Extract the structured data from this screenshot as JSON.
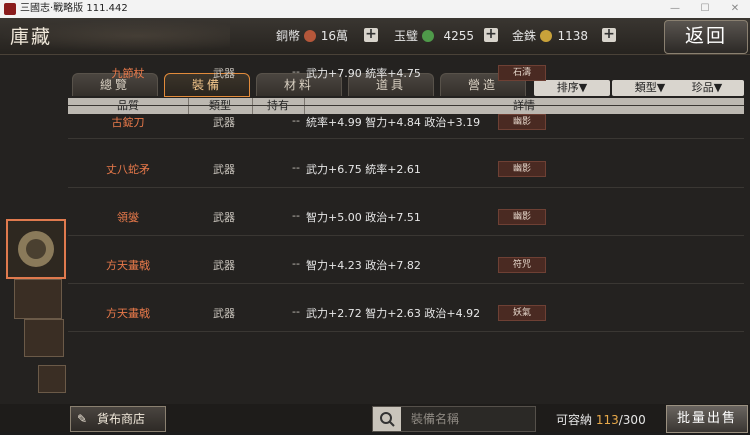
{
  "window": {
    "title": "三國志·戰略版 111.442"
  },
  "header": {
    "title": "庫藏",
    "back_label": "返回",
    "currencies": [
      {
        "label": "銅幣",
        "value": "16萬",
        "color": "#b5573a"
      },
      {
        "label": "玉璧",
        "value": "4255",
        "color": "#4f9a4a"
      },
      {
        "label": "金銖",
        "value": "1138",
        "color": "#c9a23a"
      }
    ],
    "plus_label": "+"
  },
  "tabs": [
    "總覽",
    "裝備",
    "材料",
    "道具",
    "營造"
  ],
  "active_tab": 1,
  "filters": [
    "排序▼",
    "類型▼",
    "珍品▼"
  ],
  "table": {
    "headers": [
      "品質",
      "類型",
      "持有",
      "詳情"
    ],
    "rows": [
      {
        "name": "九節杖",
        "type": "武器",
        "own": "--",
        "stats": "武力+7.90  統率+4.75",
        "tag": "石濤"
      },
      {
        "name": "古錠刀",
        "type": "武器",
        "own": "--",
        "stats": "統率+4.99  智力+4.84  政治+3.19",
        "tag": "幽影"
      },
      {
        "name": "丈八蛇矛",
        "type": "武器",
        "own": "--",
        "stats": "武力+6.75  統率+2.61",
        "tag": "幽影"
      },
      {
        "name": "領燮",
        "type": "武器",
        "own": "--",
        "stats": "智力+5.00  政治+7.51",
        "tag": "幽影"
      },
      {
        "name": "方天畫戟",
        "type": "武器",
        "own": "--",
        "stats": "智力+4.23  政治+7.82",
        "tag": "符咒"
      },
      {
        "name": "方天畫戟",
        "type": "武器",
        "own": "--",
        "stats": "武力+2.72  智力+2.63  政治+4.92",
        "tag": "妖氣"
      }
    ]
  },
  "footer": {
    "shop_label": "貨布商店",
    "search_placeholder": "裝備名稱",
    "capacity_label": "可容納",
    "capacity_count": "113",
    "capacity_total": "/300",
    "sell_label": "批量出售"
  },
  "icons": {
    "close": "close-icon",
    "search": "search-icon",
    "shop": "shop-icon"
  }
}
